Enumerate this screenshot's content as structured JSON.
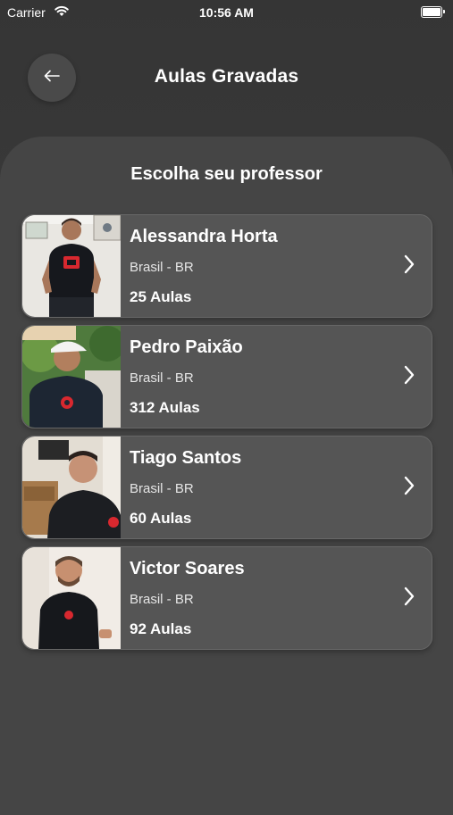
{
  "status_bar": {
    "carrier": "Carrier",
    "time": "10:56 AM"
  },
  "header": {
    "title": "Aulas Gravadas"
  },
  "section": {
    "title": "Escolha seu professor"
  },
  "teachers": [
    {
      "name": "Alessandra Horta",
      "country": "Brasil - BR",
      "classes": "25 Aulas"
    },
    {
      "name": "Pedro Paixão",
      "country": "Brasil - BR",
      "classes": "312 Aulas"
    },
    {
      "name": "Tiago Santos",
      "country": "Brasil - BR",
      "classes": "60 Aulas"
    },
    {
      "name": "Victor Soares",
      "country": "Brasil - BR",
      "classes": "92 Aulas"
    }
  ]
}
